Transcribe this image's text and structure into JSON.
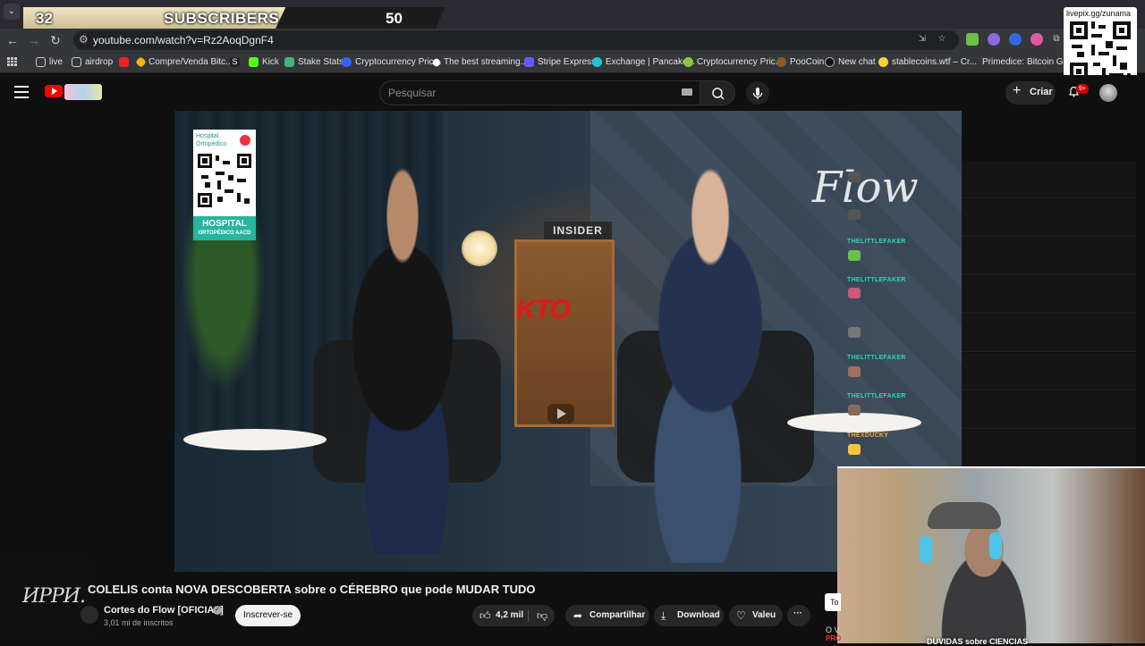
{
  "overlay": {
    "subscribers_current": "32",
    "subscribers_label": "SUBSCRIBERS",
    "subscribers_goal": "50",
    "qr_label": "livepix.gg/zunama"
  },
  "browser": {
    "url": "youtube.com/watch?v=Rz2AoqDgnF4",
    "bookmarks": [
      {
        "label": "live",
        "icon": "folder-icon"
      },
      {
        "label": "airdrop",
        "icon": "folder-icon"
      },
      {
        "label": "Compre/Venda Bitc...",
        "icon": "binance-icon"
      },
      {
        "label": "Kick",
        "icon": "kick-icon"
      },
      {
        "label": "Stake Stats",
        "icon": "stake-icon"
      },
      {
        "label": "Cryptocurrency Pric...",
        "icon": "coinmarketcap-icon"
      },
      {
        "label": "The best streaming...",
        "icon": "streaming-icon"
      },
      {
        "label": "Stripe Express",
        "icon": "stripe-icon"
      },
      {
        "label": "Exchange | Pancake...",
        "icon": "pancake-icon"
      },
      {
        "label": "Cryptocurrency Pric...",
        "icon": "coingecko-icon"
      },
      {
        "label": "PooCoin",
        "icon": "poocoin-icon"
      },
      {
        "label": "New chat",
        "icon": "chatgpt-icon"
      },
      {
        "label": "stablecoins.wtf – Cr...",
        "icon": "stablecoins-icon"
      },
      {
        "label": "Primedice: Bitcoin G...",
        "icon": "primedice-icon"
      }
    ]
  },
  "youtube": {
    "search_placeholder": "Pesquisar",
    "create_label": "Criar",
    "notification_count": "9+"
  },
  "video": {
    "title": "COLELIS conta NOVA DESCOBERTA sobre o CÉREBRO que pode MUDAR TUDO",
    "channel_name": "Cortes do Flow [OFICIAL]",
    "channel_subs": "3,01 mi de inscritos",
    "subscribe_label": "Inscrever-se",
    "likes": "4,2 mil",
    "share_label": "Compartilhar",
    "download_label": "Download",
    "thanks_label": "Valeu",
    "scene_insider": "INSIDER",
    "scene_kto": "KTO",
    "scene_flow": "Flow",
    "sponsor_top": "Hospital Ortopédico",
    "sponsor_bottom_main": "HOSPITAL",
    "sponsor_bottom_sub": "ORTOPÉDICO AACD"
  },
  "chat": [
    {
      "user": "",
      "color": "#e0313a"
    },
    {
      "user": "",
      "color": "#e0313a"
    },
    {
      "user": "THELITTLEFAKER",
      "color": "#28d7b5"
    },
    {
      "user": "THELITTLEFAKER",
      "color": "#28d7b5"
    },
    {
      "user": "",
      "color": "#c21b5a"
    },
    {
      "user": "THELITTLEFAKER",
      "color": "#28d7b5"
    },
    {
      "user": "THELITTLEFAKER",
      "color": "#28d7b5"
    },
    {
      "user": "THEXDUCKY",
      "color": "#f2a73a"
    }
  ],
  "webcam": {
    "caption": "DUVIDAS sobre CIENCIAS",
    "left_text": "O V",
    "left_red": "PRO",
    "tooltip": "To"
  },
  "streamer_watermark": "ИPPИ."
}
